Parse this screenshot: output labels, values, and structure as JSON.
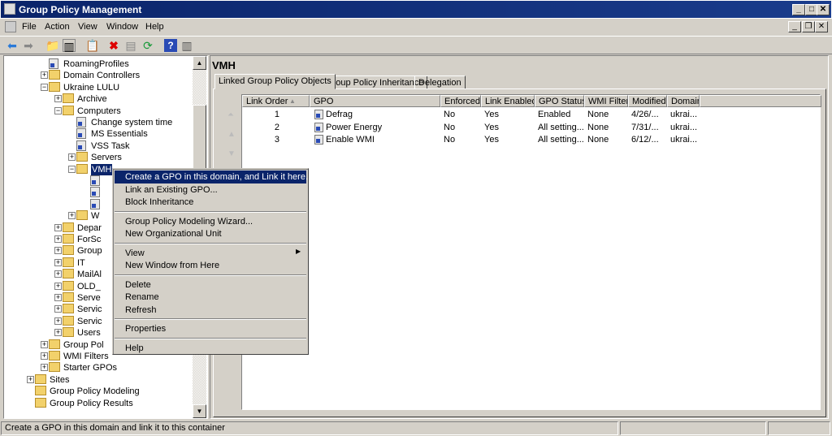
{
  "window": {
    "title": "Group Policy Management"
  },
  "menu": [
    "File",
    "Action",
    "View",
    "Window",
    "Help"
  ],
  "toolbar": [
    "back-icon",
    "forward-icon",
    "up-folder-icon",
    "show-hide-tree-icon",
    "properties-icon",
    "delete-icon",
    "export-icon",
    "refresh-icon",
    "help-icon",
    "action-pane-icon"
  ],
  "tree": [
    {
      "label": "RoamingProfiles",
      "level": 1,
      "exp": "",
      "icon": "gpo"
    },
    {
      "label": "Domain Controllers",
      "level": 1,
      "exp": "+",
      "icon": "folder"
    },
    {
      "label": "Ukraine LULU",
      "level": 1,
      "exp": "-",
      "icon": "folder"
    },
    {
      "label": "Archive",
      "level": 2,
      "exp": "+",
      "icon": "folder"
    },
    {
      "label": "Computers",
      "level": 2,
      "exp": "-",
      "icon": "folder"
    },
    {
      "label": "Change system time",
      "level": 3,
      "exp": "",
      "icon": "gpo"
    },
    {
      "label": "MS Essentials",
      "level": 3,
      "exp": "",
      "icon": "gpo"
    },
    {
      "label": "VSS Task",
      "level": 3,
      "exp": "",
      "icon": "gpo"
    },
    {
      "label": "Servers",
      "level": 3,
      "exp": "+",
      "icon": "folder"
    },
    {
      "label": "VMH",
      "level": 3,
      "exp": "-",
      "icon": "folder",
      "selected": true
    },
    {
      "label": "",
      "level": 4,
      "exp": "",
      "icon": "gpo"
    },
    {
      "label": "",
      "level": 4,
      "exp": "",
      "icon": "gpo"
    },
    {
      "label": "",
      "level": 4,
      "exp": "",
      "icon": "gpo"
    },
    {
      "label": "W",
      "level": 3,
      "exp": "+",
      "icon": "folder"
    },
    {
      "label": "Depar",
      "level": 2,
      "exp": "+",
      "icon": "folder"
    },
    {
      "label": "ForSc",
      "level": 2,
      "exp": "+",
      "icon": "folder"
    },
    {
      "label": "Group",
      "level": 2,
      "exp": "+",
      "icon": "folder"
    },
    {
      "label": "IT",
      "level": 2,
      "exp": "+",
      "icon": "folder"
    },
    {
      "label": "MailAl",
      "level": 2,
      "exp": "+",
      "icon": "folder"
    },
    {
      "label": "OLD_",
      "level": 2,
      "exp": "+",
      "icon": "folder"
    },
    {
      "label": "Serve",
      "level": 2,
      "exp": "+",
      "icon": "folder"
    },
    {
      "label": "Servic",
      "level": 2,
      "exp": "+",
      "icon": "folder"
    },
    {
      "label": "Servic",
      "level": 2,
      "exp": "+",
      "icon": "folder"
    },
    {
      "label": "Users",
      "level": 2,
      "exp": "+",
      "icon": "folder"
    },
    {
      "label": "Group Pol",
      "level": 1,
      "exp": "+",
      "icon": "folder"
    },
    {
      "label": "WMI Filters",
      "level": 1,
      "exp": "+",
      "icon": "folder"
    },
    {
      "label": "Starter GPOs",
      "level": 1,
      "exp": "+",
      "icon": "folder"
    },
    {
      "label": "Sites",
      "level": 0,
      "exp": "+",
      "icon": "folder"
    },
    {
      "label": "Group Policy Modeling",
      "level": 0,
      "exp": "",
      "icon": "folder"
    },
    {
      "label": "Group Policy Results",
      "level": 0,
      "exp": "",
      "icon": "folder"
    }
  ],
  "context_menu": [
    {
      "label": "Create a GPO in this domain, and Link it here...",
      "highlighted": true
    },
    {
      "label": "Link an Existing GPO..."
    },
    {
      "label": "Block Inheritance"
    },
    {
      "sep": true
    },
    {
      "label": "Group Policy Modeling Wizard..."
    },
    {
      "label": "New Organizational Unit"
    },
    {
      "sep": true
    },
    {
      "label": "View",
      "submenu": true
    },
    {
      "label": "New Window from Here"
    },
    {
      "sep": true
    },
    {
      "label": "Delete"
    },
    {
      "label": "Rename"
    },
    {
      "label": "Refresh"
    },
    {
      "sep": true
    },
    {
      "label": "Properties"
    },
    {
      "sep": true
    },
    {
      "label": "Help"
    }
  ],
  "right": {
    "heading": "VMH",
    "tabs": [
      "Linked Group Policy Objects",
      "Group Policy Inheritance",
      "Delegation"
    ],
    "active_tab": 0,
    "columns": [
      "Link Order",
      "GPO",
      "Enforced",
      "Link Enabled",
      "GPO Status",
      "WMI Filter",
      "Modified",
      "Domain"
    ],
    "sort_column": "Link Order",
    "rows": [
      [
        "1",
        "Defrag",
        "No",
        "Yes",
        "Enabled",
        "None",
        "4/26/...",
        "ukrai..."
      ],
      [
        "2",
        "Power Energy",
        "No",
        "Yes",
        "All setting...",
        "None",
        "7/31/...",
        "ukrai..."
      ],
      [
        "3",
        "Enable WMI",
        "No",
        "Yes",
        "All setting...",
        "None",
        "6/12/...",
        "ukrai..."
      ]
    ]
  },
  "status": {
    "text": "Create a GPO in this domain and link it to this container"
  }
}
